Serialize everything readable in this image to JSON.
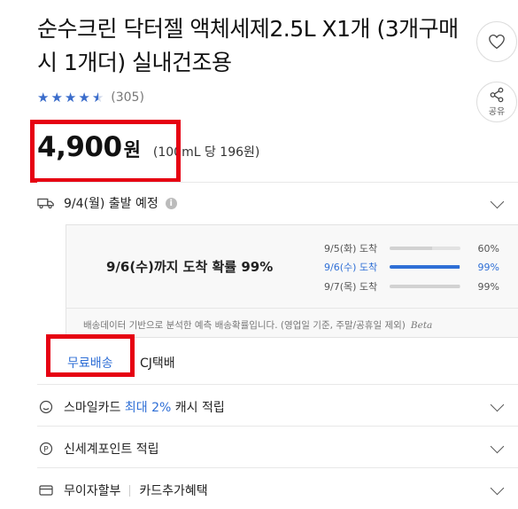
{
  "product": {
    "title": "순수크린 닥터젤 액체세제2.5L X1개 (3개구매시 1개더) 실내건조용",
    "rating_stars": 4.5,
    "review_count": "(305)",
    "price": "4,900",
    "currency": "원",
    "unit_price": "(100mL 당 196원)"
  },
  "actions": {
    "share_label": "공유"
  },
  "shipping": {
    "depart_text": "9/4(월) 출발 예정",
    "arrive_text": "9/6(수)까지 도착 확률 99%",
    "probabilities": [
      {
        "label": "9/5(화) 도착",
        "percent": "60%",
        "value": 0.6
      },
      {
        "label": "9/6(수) 도착",
        "percent": "99%",
        "value": 0.99
      },
      {
        "label": "9/7(목) 도착",
        "percent": "99%",
        "value": 0.99
      }
    ],
    "note": "배송데이터 기반으로 분석한 예측 배송확률입니다. (영업일 기준, 주말/공휴일 제외)",
    "beta": "Beta",
    "free_shipping": "무료배송",
    "carrier": "CJ택배"
  },
  "benefits": {
    "smilecard_prefix": "스마일카드",
    "smilecard_highlight": "최대 2%",
    "smilecard_suffix": "캐시 적립",
    "shinsegae": "신세계포인트 적립",
    "installment": "무이자할부",
    "card_benefit": "카드추가혜택"
  },
  "colors": {
    "accent": "#2f6fd6",
    "highlight_box": "#e60012",
    "star": "#3a6ccb"
  }
}
